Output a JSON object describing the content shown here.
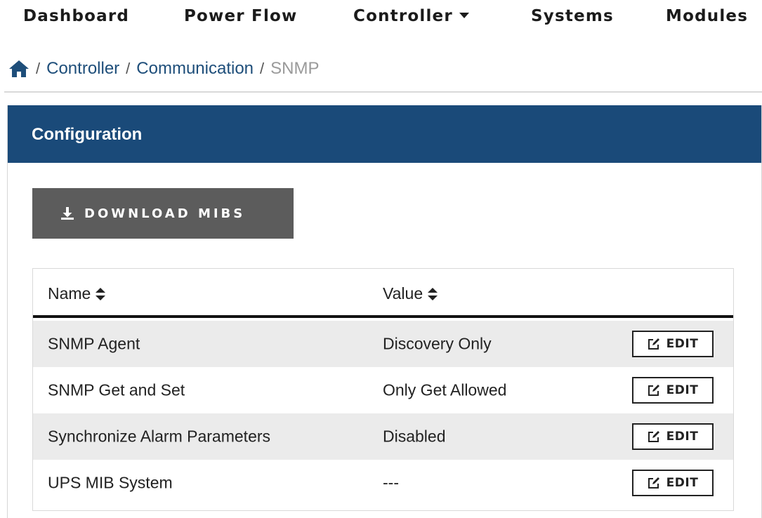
{
  "nav": {
    "items": [
      {
        "label": "Dashboard",
        "has_dropdown": false
      },
      {
        "label": "Power Flow",
        "has_dropdown": false
      },
      {
        "label": "Controller",
        "has_dropdown": true
      },
      {
        "label": "Systems",
        "has_dropdown": false
      },
      {
        "label": "Modules",
        "has_dropdown": false
      }
    ]
  },
  "breadcrumb": {
    "home_icon": "home-icon",
    "separator": "/",
    "links": [
      "Controller",
      "Communication"
    ],
    "current": "SNMP"
  },
  "panel": {
    "title": "Configuration",
    "header_color": "#1a4a79",
    "download_button": {
      "label": "DOWNLOAD MIBS",
      "icon": "download-icon"
    }
  },
  "table": {
    "columns": [
      {
        "label": "Name",
        "sortable": true
      },
      {
        "label": "Value",
        "sortable": true
      }
    ],
    "rows": [
      {
        "name": "SNMP Agent",
        "value": "Discovery Only",
        "action": "EDIT"
      },
      {
        "name": "SNMP Get and Set",
        "value": "Only Get Allowed",
        "action": "EDIT"
      },
      {
        "name": "Synchronize Alarm Parameters",
        "value": "Disabled",
        "action": "EDIT"
      },
      {
        "name": "UPS MIB System",
        "value": "---",
        "action": "EDIT"
      }
    ]
  }
}
